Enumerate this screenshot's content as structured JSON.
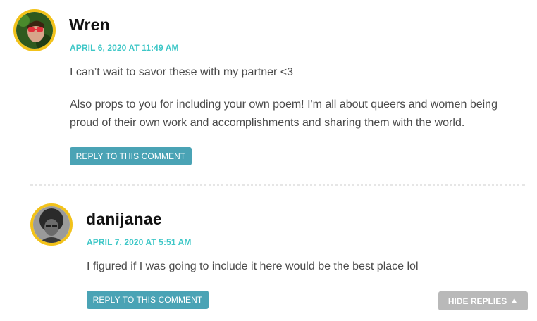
{
  "comments": [
    {
      "author": "Wren",
      "date": "April 6, 2020 at 11:49 AM",
      "paragraphs": [
        "I can’t wait to savor these with my partner <3",
        "Also props to you for including your own poem! I'm all about queers and women being proud of their own work and accomplishments and sharing them with the world."
      ],
      "reply_label": "Reply to this comment"
    },
    {
      "author": "danijanae",
      "date": "April 7, 2020 at 5:51 AM",
      "paragraphs": [
        "I figured if I was going to include it here would be the best place lol"
      ],
      "reply_label": "Reply to this comment"
    }
  ],
  "hide_replies_label": "Hide Replies",
  "hide_replies_icon": "caret-up-icon",
  "colors": {
    "accent_date": "#3ec7c7",
    "reply_button": "#4aa3b5",
    "hide_button": "#b9b9b9",
    "avatar_ring": "#f2c21a"
  }
}
